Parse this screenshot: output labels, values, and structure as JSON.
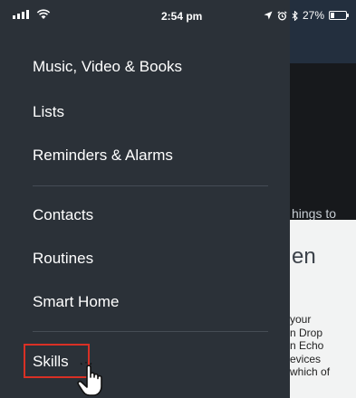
{
  "status_bar": {
    "time": "2:54 pm",
    "battery": "27%",
    "battery_level": 0.27,
    "icons": [
      "signal-icon",
      "wifi-icon",
      "location-icon",
      "alarm-icon",
      "bluetooth-icon",
      "battery-icon"
    ]
  },
  "menu": {
    "items": [
      {
        "label": "Music, Video & Books"
      },
      {
        "label": "Lists"
      },
      {
        "label": "Reminders & Alarms"
      },
      {
        "label": "Contacts"
      },
      {
        "label": "Routines"
      },
      {
        "label": "Smart Home"
      },
      {
        "label": "Skills",
        "highlighted": true
      }
    ]
  },
  "background": {
    "card_text": "hings to",
    "heading": "en",
    "body_lines": [
      "your",
      "n Drop",
      "n Echo",
      "evices",
      "which of"
    ]
  },
  "colors": {
    "drawer": "#2b3138",
    "highlight_border": "#d93025",
    "topbar": "#232f3e"
  }
}
